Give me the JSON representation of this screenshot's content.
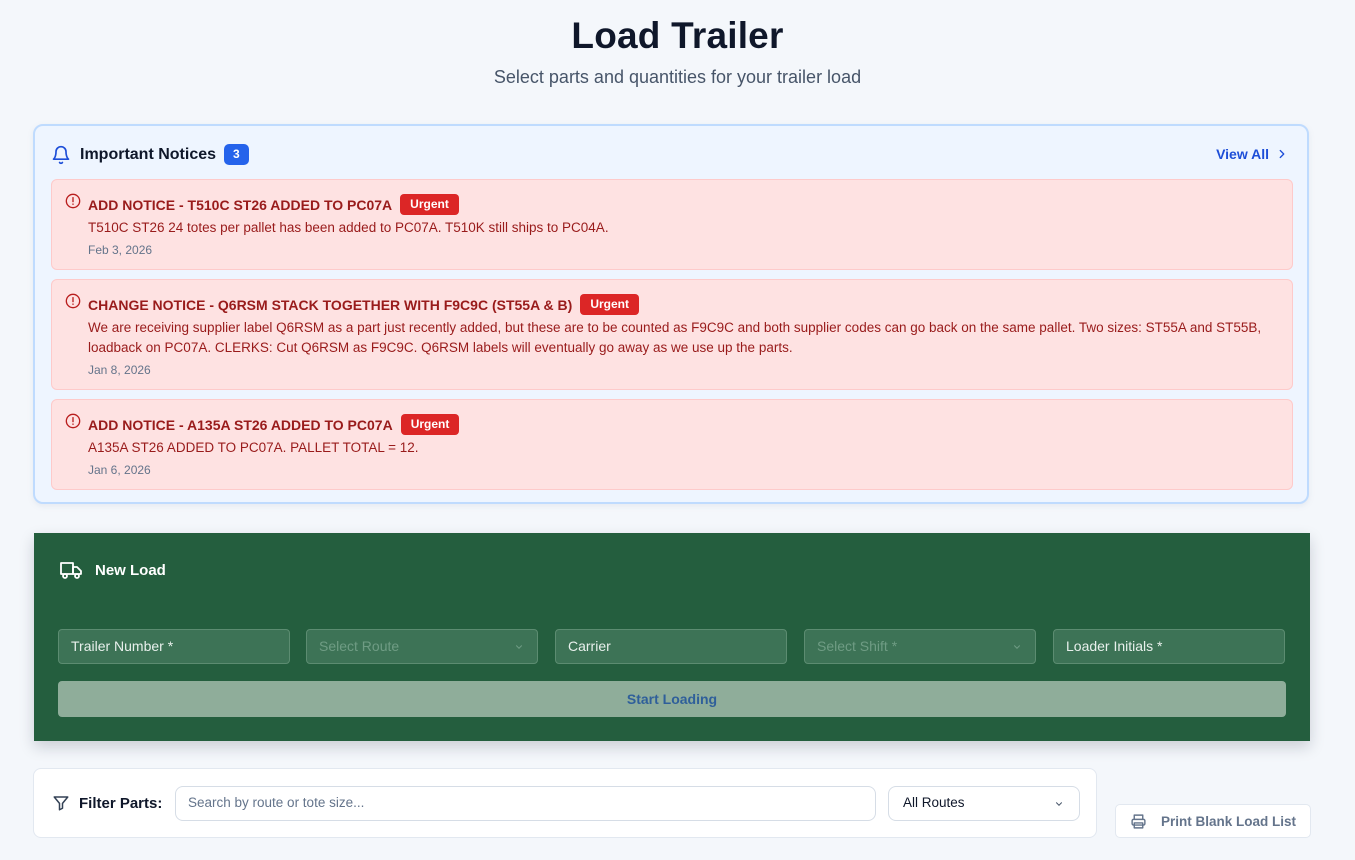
{
  "header": {
    "title": "Load Trailer",
    "subtitle": "Select parts and quantities for your trailer load"
  },
  "notices": {
    "title": "Important Notices",
    "count": "3",
    "view_all": "View All",
    "items": [
      {
        "title": "ADD NOTICE - T510C ST26 ADDED TO PC07A",
        "badge": "Urgent",
        "body": "T510C ST26 24 totes per pallet has been added to PC07A. T510K still ships to PC04A.",
        "date": "Feb 3, 2026"
      },
      {
        "title": "CHANGE NOTICE - Q6RSM STACK TOGETHER WITH F9C9C (ST55A & B)",
        "badge": "Urgent",
        "body": "We are receiving supplier label Q6RSM as a part just recently added, but these are to be counted as F9C9C and both supplier codes can go back on the same pallet. Two sizes: ST55A and ST55B, loadback on PC07A. CLERKS: Cut Q6RSM as F9C9C. Q6RSM labels will eventually go away as we use up the parts.",
        "date": "Jan 8, 2026"
      },
      {
        "title": "ADD NOTICE - A135A ST26 ADDED TO PC07A",
        "badge": "Urgent",
        "body": "A135A ST26 ADDED TO PC07A. PALLET TOTAL = 12.",
        "date": "Jan 6, 2026"
      }
    ]
  },
  "new_load": {
    "title": "New Load",
    "trailer_placeholder": "Trailer Number *",
    "route_placeholder": "Select Route",
    "carrier_placeholder": "Carrier",
    "shift_placeholder": "Select Shift *",
    "loader_placeholder": "Loader Initials *",
    "start_label": "Start Loading"
  },
  "filter": {
    "label": "Filter Parts:",
    "search_placeholder": "Search by route or tote size...",
    "route_selected": "All Routes",
    "print_label": "Print Blank Load List"
  },
  "colors": {
    "primary_blue": "#2563eb",
    "urgent_red": "#dc2626",
    "panel_green": "#245e3e",
    "notice_bg": "#fee2e2"
  },
  "icons": [
    "bell-icon",
    "chevron-right-icon",
    "alert-circle-icon",
    "truck-icon",
    "chevron-down-icon",
    "filter-icon",
    "printer-icon"
  ]
}
